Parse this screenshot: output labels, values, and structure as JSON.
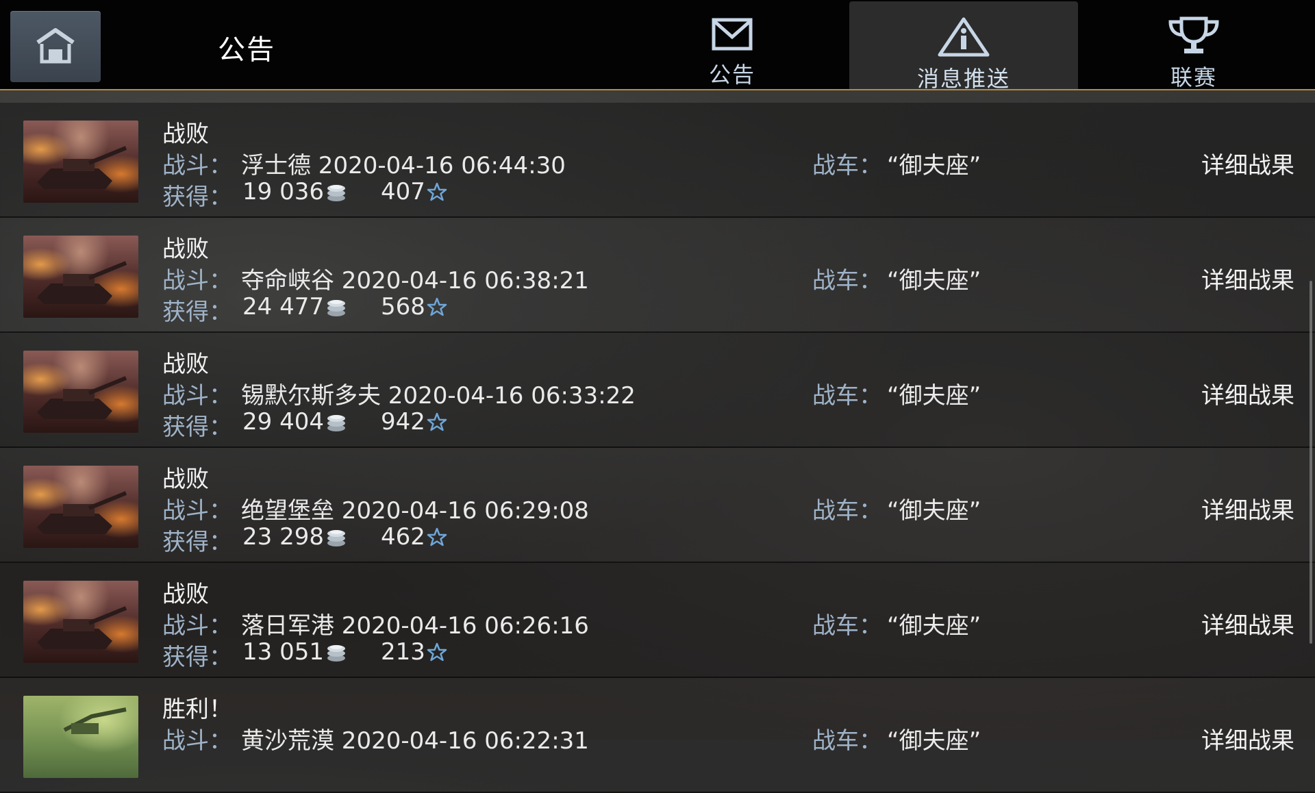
{
  "header": {
    "title": "公告",
    "tabs": [
      {
        "label": "公告",
        "icon": "envelope-icon",
        "active": false
      },
      {
        "label": "消息推送",
        "icon": "warning-triangle-icon",
        "active": true
      },
      {
        "label": "联赛",
        "icon": "trophy-icon",
        "active": false
      }
    ]
  },
  "labels": {
    "battle": "战斗：",
    "earned": "获得：",
    "tank": "战车：",
    "details": "详细战果"
  },
  "battles": [
    {
      "result": "战败",
      "map_time": "浮士德 2020-04-16 06:44:30",
      "credits": "19 036",
      "xp": "407",
      "tank": "“御夫座”",
      "outcome": "defeat"
    },
    {
      "result": "战败",
      "map_time": "夺命峡谷 2020-04-16 06:38:21",
      "credits": "24 477",
      "xp": "568",
      "tank": "“御夫座”",
      "outcome": "defeat"
    },
    {
      "result": "战败",
      "map_time": "锡默尔斯多夫 2020-04-16 06:33:22",
      "credits": "29 404",
      "xp": "942",
      "tank": "“御夫座”",
      "outcome": "defeat"
    },
    {
      "result": "战败",
      "map_time": "绝望堡垒 2020-04-16 06:29:08",
      "credits": "23 298",
      "xp": "462",
      "tank": "“御夫座”",
      "outcome": "defeat"
    },
    {
      "result": "战败",
      "map_time": "落日军港 2020-04-16 06:26:16",
      "credits": "13 051",
      "xp": "213",
      "tank": "“御夫座”",
      "outcome": "defeat"
    },
    {
      "result": "胜利！",
      "map_time": "黄沙荒漠 2020-04-16 06:22:31",
      "credits": "",
      "xp": "",
      "tank": "“御夫座”",
      "outcome": "victory"
    }
  ],
  "colors": {
    "accent_border": "#b98a3c",
    "label_blue": "#9fb3c8",
    "star_blue": "#6fa6d8"
  }
}
